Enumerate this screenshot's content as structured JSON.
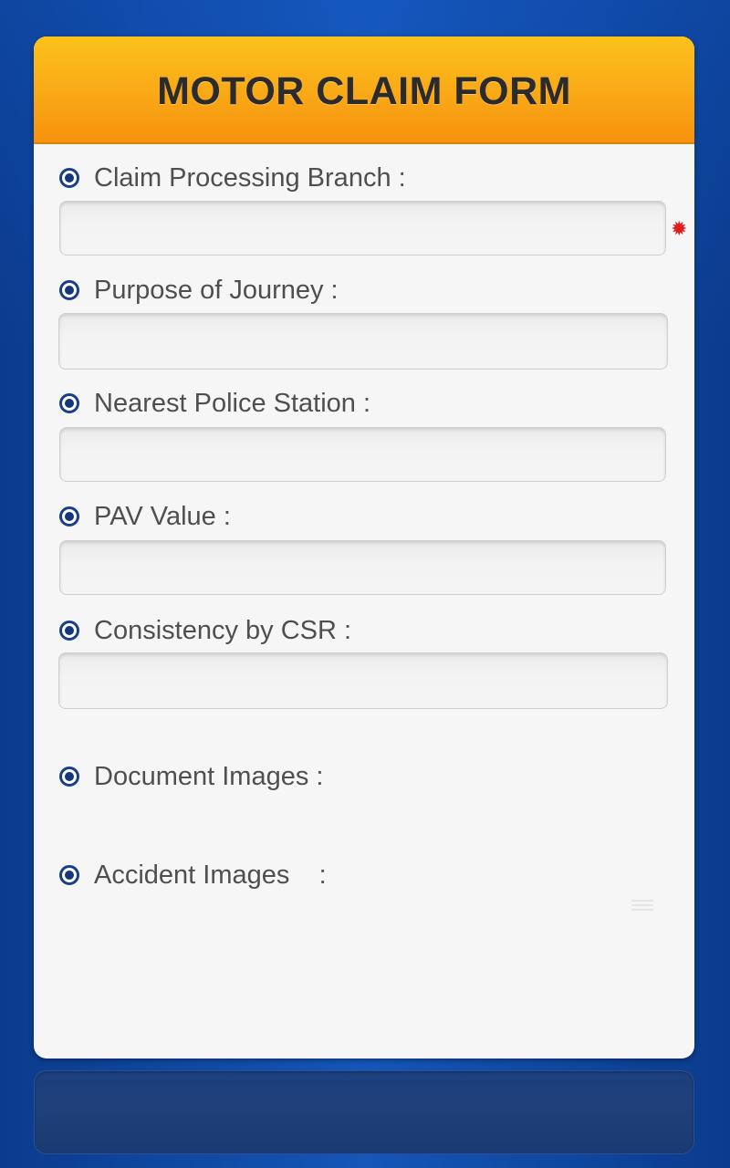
{
  "form": {
    "title": "MOTOR CLAIM FORM",
    "required_marker": "✹",
    "fields": [
      {
        "label": "Claim Processing Branch :",
        "value": "",
        "required": true
      },
      {
        "label": "Purpose of Journey :",
        "value": ""
      },
      {
        "label": "Nearest Police Station :",
        "value": ""
      },
      {
        "label": "PAV Value :",
        "value": ""
      },
      {
        "label": "Consistency by CSR :",
        "value": ""
      }
    ],
    "sections": [
      {
        "label": "Document Images :"
      },
      {
        "label": "Accident Images    :"
      }
    ]
  },
  "colors": {
    "header_orange": "#f9a817",
    "background_blue": "#0d47a1",
    "radio_blue": "#14367a",
    "required_red": "#e21b1b"
  },
  "icons": {
    "bullet": "radio-selected-icon",
    "required": "asterisk-icon",
    "menu": "menu-icon"
  }
}
